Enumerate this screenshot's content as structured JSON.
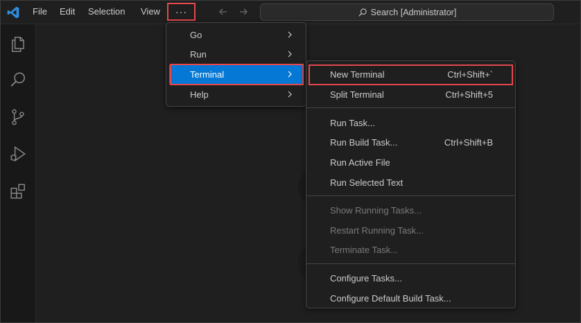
{
  "titlebar": {
    "menus": [
      "File",
      "Edit",
      "Selection",
      "View"
    ],
    "more_label": "···",
    "search_text": "Search [Administrator]"
  },
  "activity_icons": [
    "files-icon",
    "search-icon",
    "source-control-icon",
    "run-debug-icon",
    "extensions-icon"
  ],
  "more_menu": {
    "items": [
      {
        "label": "Go",
        "submenu": true
      },
      {
        "label": "Run",
        "submenu": true
      },
      {
        "label": "Terminal",
        "submenu": true,
        "active": true
      },
      {
        "label": "Help",
        "submenu": true
      }
    ]
  },
  "terminal_menu": {
    "groups": [
      [
        {
          "label": "New Terminal",
          "shortcut": "Ctrl+Shift+`"
        },
        {
          "label": "Split Terminal",
          "shortcut": "Ctrl+Shift+5"
        }
      ],
      [
        {
          "label": "Run Task...",
          "shortcut": ""
        },
        {
          "label": "Run Build Task...",
          "shortcut": "Ctrl+Shift+B"
        },
        {
          "label": "Run Active File",
          "shortcut": ""
        },
        {
          "label": "Run Selected Text",
          "shortcut": ""
        }
      ],
      [
        {
          "label": "Show Running Tasks...",
          "shortcut": "",
          "disabled": true
        },
        {
          "label": "Restart Running Task...",
          "shortcut": "",
          "disabled": true
        },
        {
          "label": "Terminate Task...",
          "shortcut": "",
          "disabled": true
        }
      ],
      [
        {
          "label": "Configure Tasks...",
          "shortcut": ""
        },
        {
          "label": "Configure Default Build Task...",
          "shortcut": ""
        }
      ]
    ]
  },
  "colors": {
    "accent": "#0478d4",
    "highlight": "#e5484d",
    "background": "#1f1f1f"
  }
}
